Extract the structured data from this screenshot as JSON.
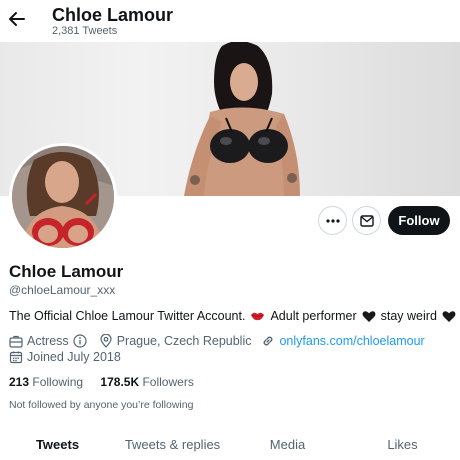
{
  "header": {
    "name": "Chloe Lamour",
    "tweet_count": "2,381 Tweets"
  },
  "profile": {
    "display_name": "Chloe Lamour",
    "handle": "@chloeLamour_xxx",
    "bio": {
      "part1": "The Official Chloe Lamour Twitter Account.",
      "part2": "Adult performer",
      "part3": "stay weird"
    },
    "category": "Actress",
    "location": "Prague, Czech Republic",
    "website": "onlyfans.com/chloelamour",
    "joined": "Joined July 2018",
    "following_count": "213",
    "following_label": "Following",
    "followers_count": "178.5K",
    "followers_label": "Followers",
    "not_followed_text": "Not followed by anyone you’re following"
  },
  "actions": {
    "follow_label": "Follow"
  },
  "tabs": [
    {
      "label": "Tweets",
      "active": true
    },
    {
      "label": "Tweets & replies",
      "active": false
    },
    {
      "label": "Media",
      "active": false
    },
    {
      "label": "Likes",
      "active": false
    }
  ],
  "colors": {
    "accent": "#1d9bf0",
    "text": "#0f1419",
    "muted": "#536471",
    "follow_bg": "#0f1419"
  }
}
